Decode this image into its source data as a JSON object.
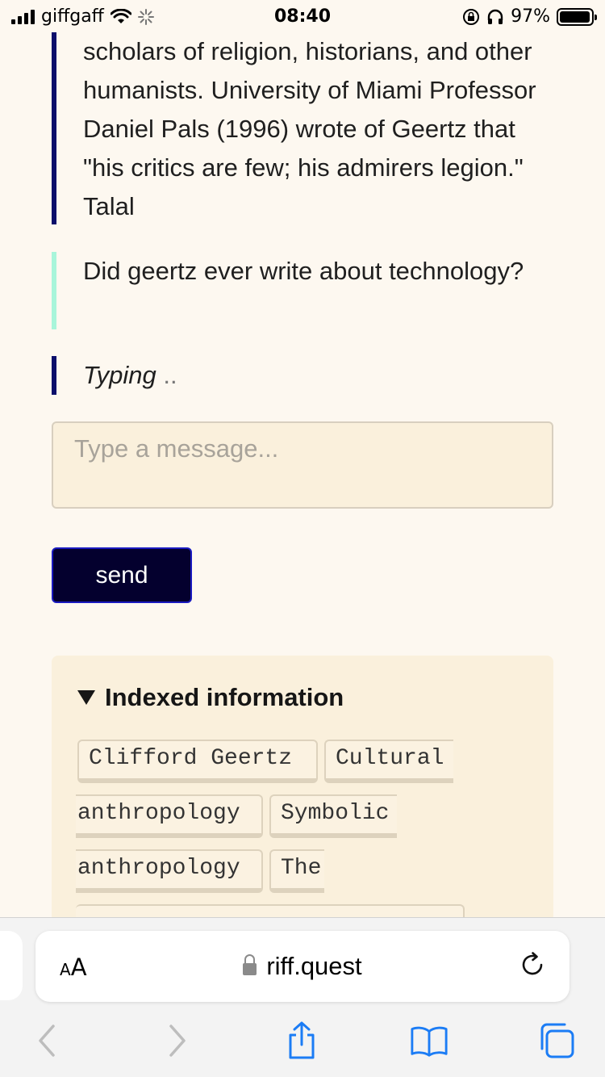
{
  "status_bar": {
    "carrier": "giffgaff",
    "time": "08:40",
    "battery": "97%",
    "icons": [
      "signal-icon",
      "wifi-icon",
      "loading-icon",
      "rotation-lock-icon",
      "headphones-icon",
      "battery-icon"
    ]
  },
  "chat": {
    "bot_message": "scholars of religion, historians, and other humanists. University of Miami Professor Daniel Pals (1996) wrote of Geertz that \"his critics are few; his admirers legion.\" Talal",
    "user_message": "Did geertz ever write about technology?",
    "typing_label": "Typing",
    "typing_dots": ".."
  },
  "composer": {
    "placeholder": "Type a message...",
    "send_label": "send"
  },
  "indexed": {
    "title": "Indexed information",
    "tags": [
      "Clifford Geertz",
      "Cultural",
      "anthropology",
      "Symbolic",
      "anthropology",
      "The"
    ]
  },
  "browser": {
    "aa_small": "A",
    "aa_big": "A",
    "url": "riff.quest"
  },
  "colors": {
    "bot_accent": "#0b0f6b",
    "user_accent": "#a8f5da",
    "send_button": "#04002e",
    "ios_blue": "#1b7cf5"
  }
}
